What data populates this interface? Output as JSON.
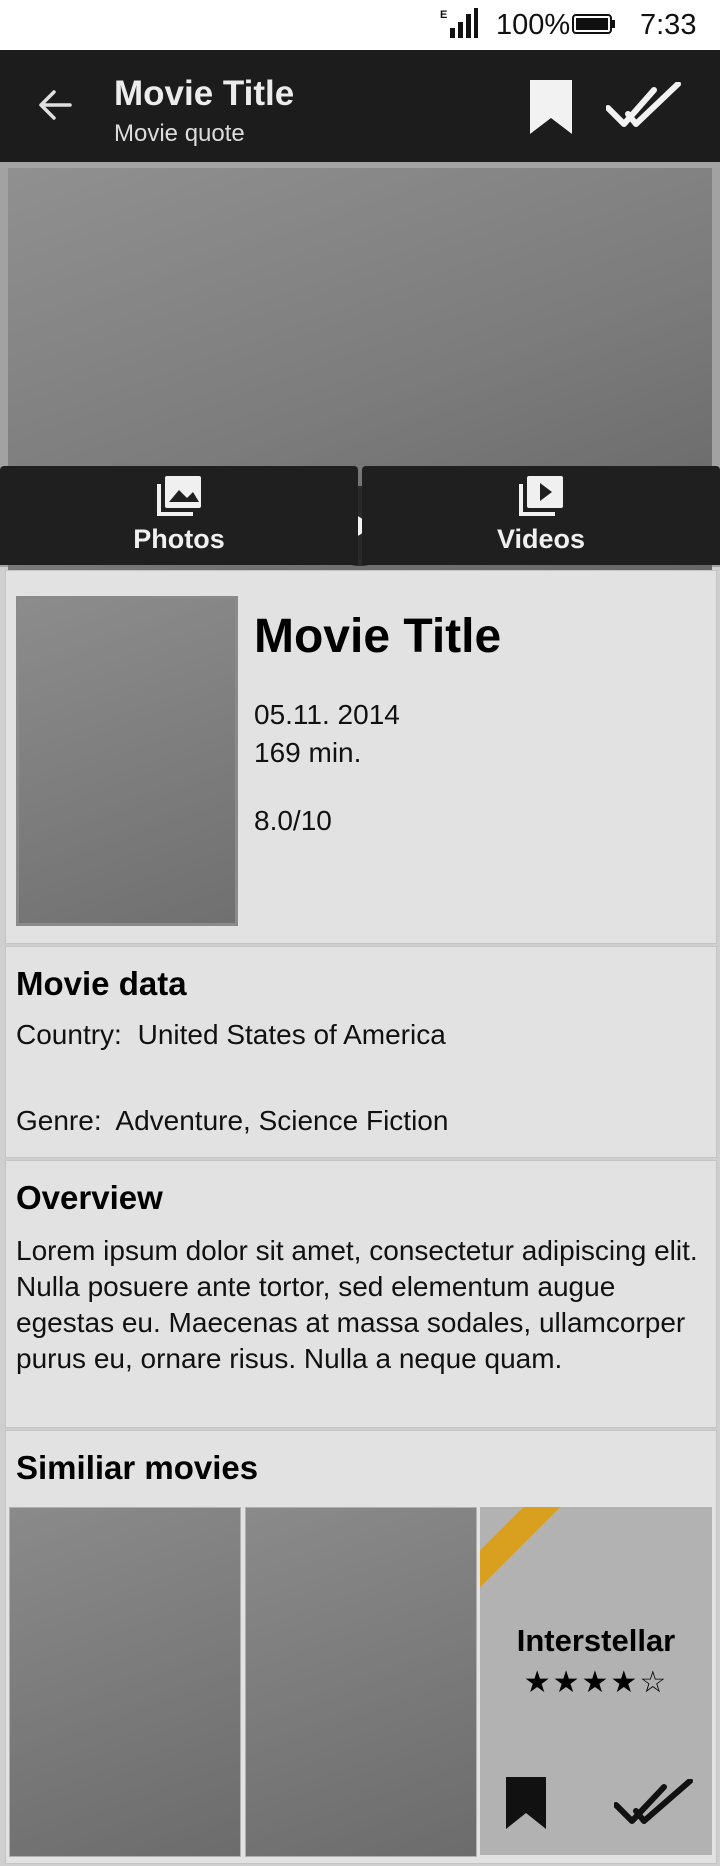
{
  "status_bar": {
    "battery": "100%",
    "time": "7:33",
    "network": "E"
  },
  "app_bar": {
    "title": "Movie Title",
    "subtitle": "Movie quote"
  },
  "media": {
    "tabs": [
      {
        "label": "Photos",
        "icon": "photos-icon"
      },
      {
        "label": "Videos",
        "icon": "videos-icon"
      }
    ]
  },
  "info": {
    "title": "Movie Title",
    "date": "05.11. 2014",
    "runtime": "169 min.",
    "rating": "8.0/10"
  },
  "movie_data": {
    "heading": "Movie data",
    "country_label": "Country:",
    "country_value": "United States of America",
    "genre_label": "Genre:",
    "genre_value": "Adventure, Science Fiction"
  },
  "overview": {
    "heading": "Overview",
    "text": "Lorem ipsum dolor sit amet, consectetur adipiscing elit. Nulla posuere ante tortor, sed elementum augue egestas eu. Maecenas at massa sodales, ullamcorper purus eu, ornare risus. Nulla a neque quam."
  },
  "similar": {
    "heading": "Similiar movies",
    "featured": {
      "title": "Interstellar",
      "stars": "★★★★☆",
      "rating_out_of_5": 4
    }
  },
  "colors": {
    "app_bar": "#1c1c1c",
    "card": "#e2e2e2",
    "ribbon": "#d9a01f"
  }
}
